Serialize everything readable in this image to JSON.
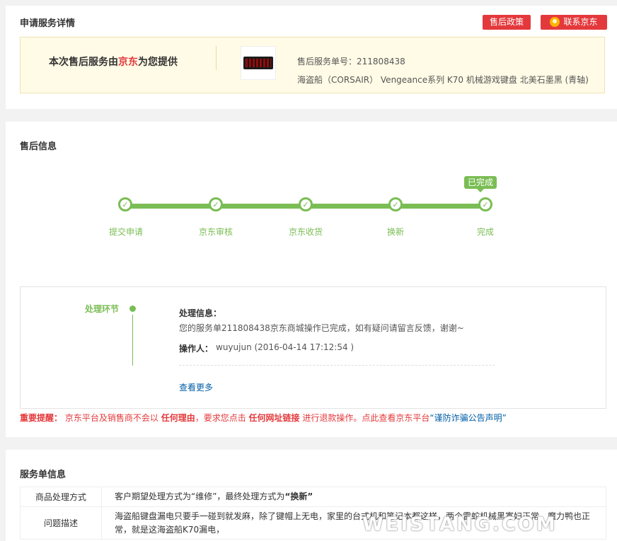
{
  "apply": {
    "title": "申请服务详情",
    "btn_policy": "售后政策",
    "btn_contact": "联系京东",
    "notice_prefix": "本次售后服务由",
    "notice_brand": "京东",
    "notice_suffix": "为您提供",
    "service_no_label": "售后服务单号：",
    "service_no": "211808438",
    "product_name": "海盗船（CORSAIR） Vengeance系列 K70 机械游戏键盘 北美石墨黑 (青轴)"
  },
  "after_sale": {
    "title": "售后信息",
    "done_tag": "已完成",
    "steps": [
      "提交申请",
      "京东审核",
      "京东收货",
      "换新",
      "完成"
    ],
    "step_check": "✓",
    "process_label": "处理环节",
    "info_label": "处理信息：",
    "info_text": "您的服务单211808438京东商城操作已完成，如有疑问请留言反馈，谢谢~",
    "operator_label": "操作人：",
    "operator": "wuyujun (2016-04-14 17:12:54 )",
    "more": "查看更多",
    "warn_label": "重要提醒：",
    "warn_1": "京东平台及销售商不会以",
    "warn_2": "任何理由",
    "warn_3": "，要求您点击",
    "warn_4": "任何网址链接",
    "warn_5": "进行退款操作。点此查看京东平台",
    "warn_link": "“谨防诈骗公告声明”"
  },
  "order": {
    "title": "服务单信息",
    "row1_key": "商品处理方式",
    "row1_prefix": "客户期望处理方式为“维修”，最终处理方式为",
    "row1_final": "“换新”",
    "row2_key": "问题描述",
    "row2_value": "海盗船键盘漏电只要手一碰到就发麻，除了键帽上无电，家里的台式机和笔记本都这样，两个雷蛇机械黑寡妇正常，魔力鸭也正常，就是这海盗船K70漏电，"
  },
  "watermark": "WEISTANG.COM",
  "colors": {
    "accent_red": "#e4393c",
    "progress_green": "#7abd54",
    "link_blue": "#005ea7",
    "notice_bg": "#fffbe6"
  }
}
